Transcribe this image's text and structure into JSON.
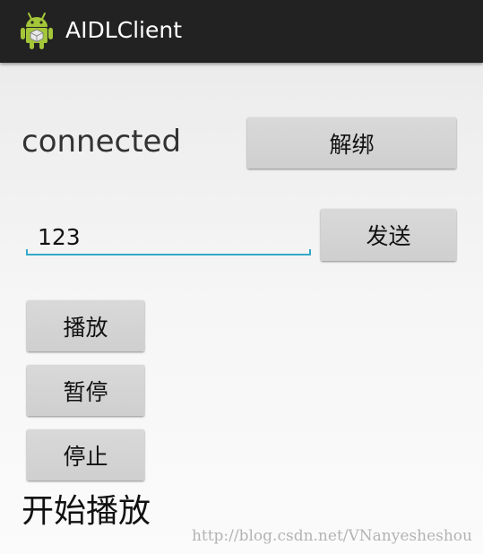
{
  "action_bar": {
    "app_icon": "android-icon",
    "title": "AIDLClient"
  },
  "main": {
    "connection_status": "connected",
    "unbind_label": "解绑",
    "message_input": {
      "value": "123",
      "placeholder": ""
    },
    "send_label": "发送",
    "play_label": "播放",
    "pause_label": "暂停",
    "stop_label": "停止",
    "playback_status": "开始播放"
  },
  "watermark": "http://blog.csdn.net/VNanyesheshou",
  "colors": {
    "action_bar": "#222222",
    "input_underline": "#33a9c9",
    "button": "#d6d6d6"
  }
}
